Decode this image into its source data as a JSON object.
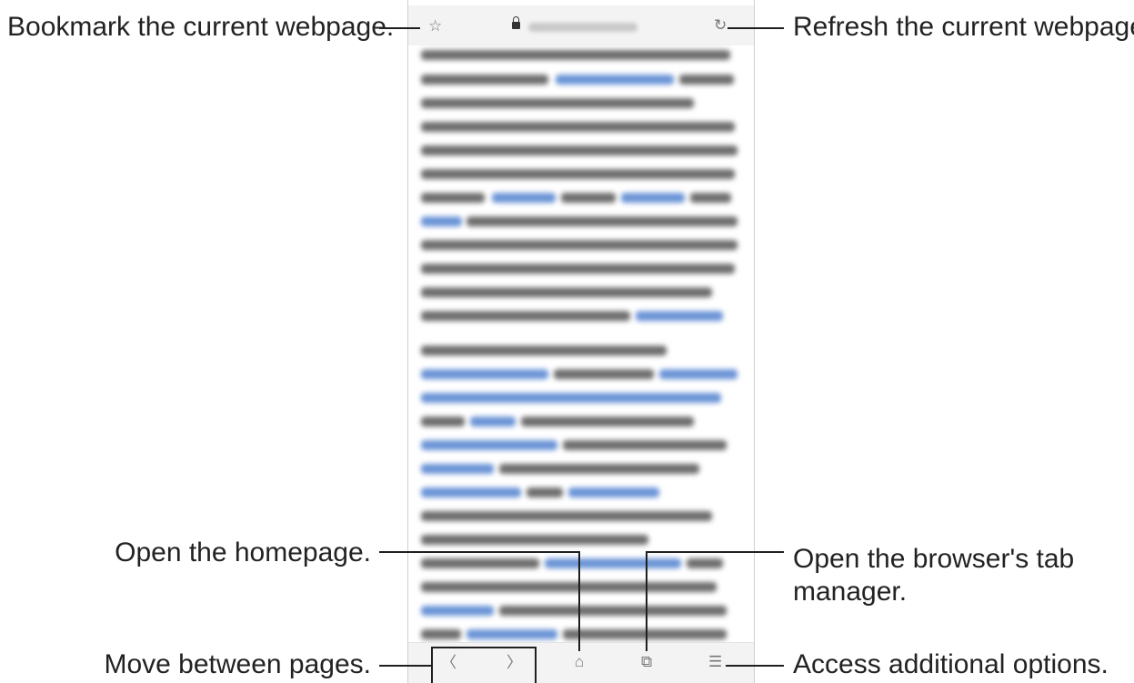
{
  "callouts": {
    "bookmark": "Bookmark the current webpage.",
    "refresh": "Refresh the current webpage.",
    "homepage": "Open the homepage.",
    "tab_manager_line1": "Open the browser's tab",
    "tab_manager_line2": "manager.",
    "move_pages": "Move between pages.",
    "options": "Access additional options."
  },
  "icons": {
    "bookmark": "☆",
    "refresh": "↻",
    "back": "〈",
    "forward": "〉",
    "home": "⌂",
    "tabs": "⧉",
    "menu": "☰"
  },
  "colors": {
    "text": "#222222",
    "line": "#1f1f1f",
    "bar_background": "#f3f3f3",
    "blurred_text": "#6d6d6d",
    "blurred_link": "#6a93d6"
  }
}
